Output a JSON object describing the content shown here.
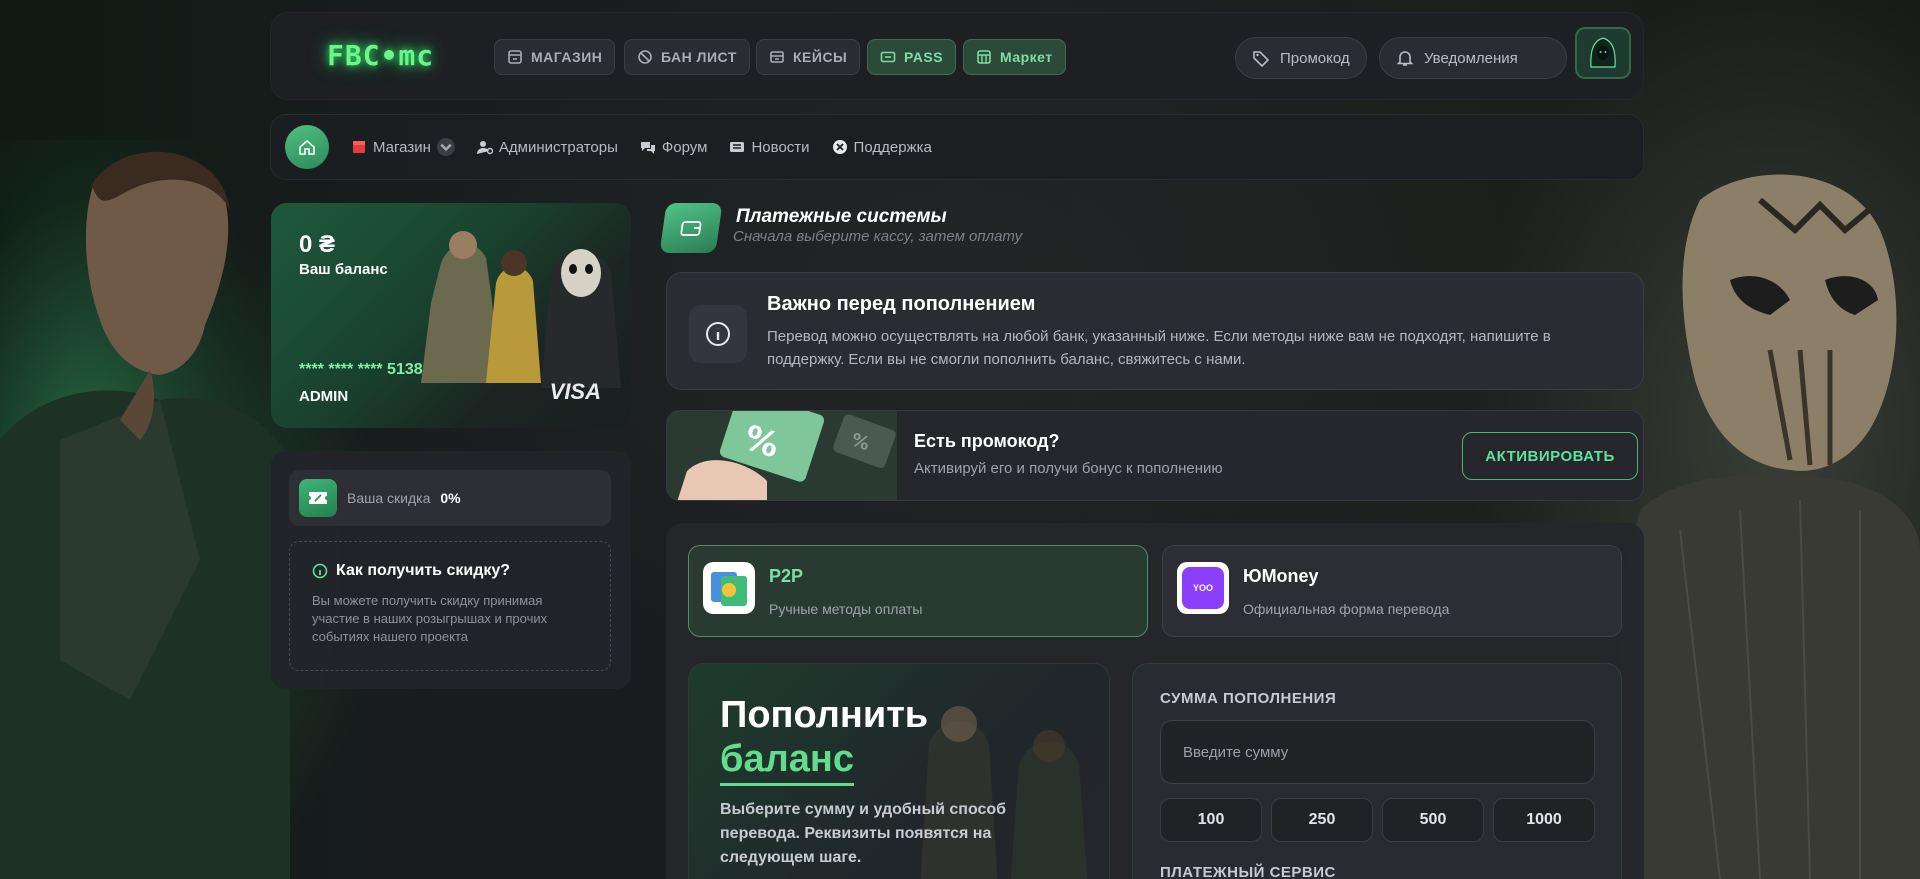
{
  "header": {
    "logo": "FBC•mc",
    "nav": [
      {
        "label": "МАГАЗИН",
        "icon": "store-icon"
      },
      {
        "label": "БАН ЛИСТ",
        "icon": "ban-icon"
      },
      {
        "label": "КЕЙСЫ",
        "icon": "case-icon"
      },
      {
        "label": "PASS",
        "icon": "ticket-icon"
      },
      {
        "label": "Маркет",
        "icon": "market-icon"
      }
    ],
    "promo_label": "Промокод",
    "notifications_label": "Уведомления"
  },
  "subnav": {
    "items": [
      {
        "label": "Магазин"
      },
      {
        "label": "Администраторы"
      },
      {
        "label": "Форум"
      },
      {
        "label": "Новости"
      },
      {
        "label": "Поддержка"
      }
    ]
  },
  "balance_card": {
    "amount": "0 ₴",
    "label": "Ваш баланс",
    "card_number": "**** **** **** 5138",
    "owner": "ADMIN",
    "brand": "VISA"
  },
  "discount": {
    "label": "Ваша скидка",
    "value": "0%",
    "howto_title": "Как получить скидку?",
    "howto_text": "Вы можете получить скидку принимая участие в наших розыгрышах и прочих событиях нашего проекта"
  },
  "payment_systems": {
    "title": "Платежные системы",
    "subtitle": "Сначала выберите кассу, затем оплату"
  },
  "notice": {
    "title": "Важно перед пополнением",
    "text": "Перевод можно осуществлять на любой банк, указанный ниже. Если методы ниже вам не подходят, напишите в поддержку. Если вы не смогли пополнить баланс, свяжитесь с нами."
  },
  "promo": {
    "title": "Есть промокод?",
    "text": "Активируй его и получи бонус к пополнению",
    "button": "АКТИВИРОВАТЬ"
  },
  "methods": [
    {
      "name": "P2P",
      "desc": "Ручные методы оплаты",
      "active": true
    },
    {
      "name": "ЮMoney",
      "desc": "Официальная форма перевода",
      "icon_text": "YOO",
      "active": false
    }
  ],
  "topup": {
    "line1": "Пополнить",
    "line2": "баланс",
    "text": "Выберите сумму и удобный способ перевода. Реквизиты появятся на следующем шаге."
  },
  "form": {
    "amount_label": "СУММА ПОПОЛНЕНИЯ",
    "amount_placeholder": "Введите сумму",
    "quick_amounts": [
      "100",
      "250",
      "500",
      "1000"
    ],
    "service_label": "ПЛАТЕЖНЫЙ СЕРВИС"
  },
  "colors": {
    "accent": "#5fe39a",
    "accent_dark": "#2e8a5a",
    "panel": "#2a2c31",
    "yoomoney": "#8b3ffd"
  }
}
